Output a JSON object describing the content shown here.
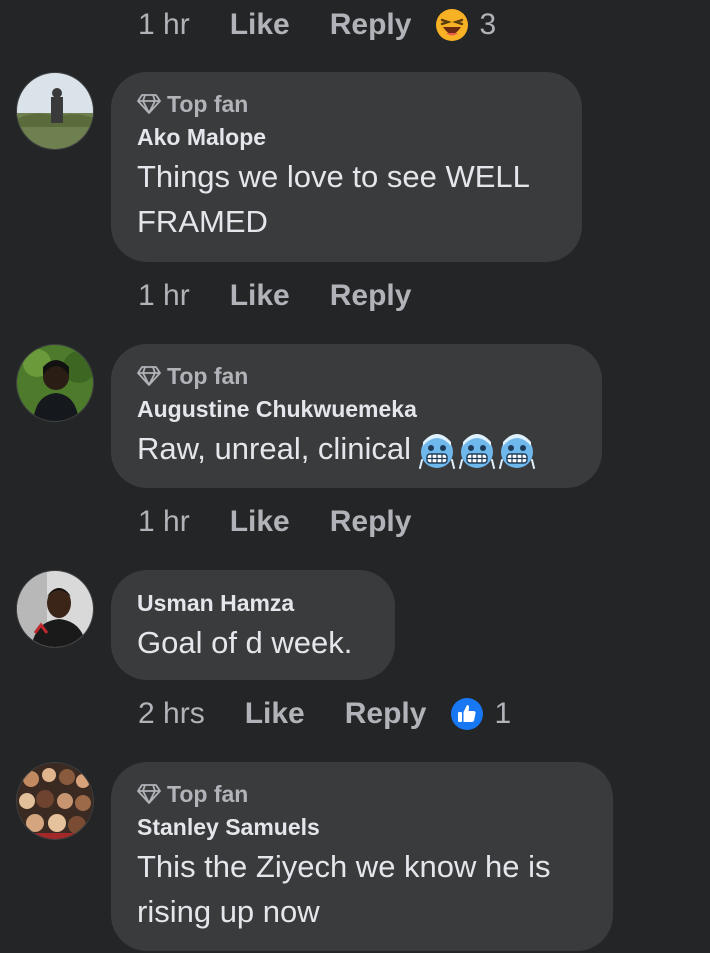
{
  "comments": [
    {
      "time": "1 hr",
      "like_label": "Like",
      "reply_label": "Reply",
      "reaction_icon": "laughing-emoji-icon",
      "reaction_count": "3"
    },
    {
      "badge": "Top fan",
      "author": "Ako Malope",
      "text": "Things we love to see WELL FRAMED",
      "time": "1 hr",
      "like_label": "Like",
      "reply_label": "Reply"
    },
    {
      "badge": "Top fan",
      "author": "Augustine Chukwuemeka",
      "text": "Raw, unreal, clinical",
      "emojis": [
        "cold-face-emoji-icon",
        "cold-face-emoji-icon",
        "cold-face-emoji-icon"
      ],
      "time": "1 hr",
      "like_label": "Like",
      "reply_label": "Reply"
    },
    {
      "author": "Usman Hamza",
      "text": "Goal of d week.",
      "time": "2 hrs",
      "like_label": "Like",
      "reply_label": "Reply",
      "reaction_icon": "like-reaction-icon",
      "reaction_count": "1"
    },
    {
      "badge": "Top fan",
      "author": "Stanley Samuels",
      "text": "This the Ziyech we know he is rising up now"
    }
  ],
  "colors": {
    "background": "#242526",
    "bubble": "#3a3b3c",
    "primary_text": "#e4e6eb",
    "secondary_text": "#b0b3b8",
    "like_blue": "#1877f2"
  }
}
